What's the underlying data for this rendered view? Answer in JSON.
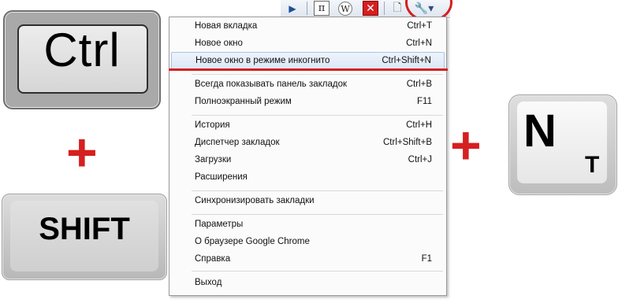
{
  "keys": {
    "ctrl": "Ctrl",
    "shift": "SHIFT",
    "n_main": "N",
    "n_sub": "T"
  },
  "plus": "+",
  "toolbar": {
    "play_icon": "▶",
    "pi_icon": "π",
    "wiki_icon": "W",
    "x_icon": "✕",
    "page_icon": "🗋",
    "wrench_icon": "🔧▾"
  },
  "menu": {
    "items": [
      {
        "label": "Новая вкладка",
        "shortcut": "Ctrl+T"
      },
      {
        "label": "Новое окно",
        "shortcut": "Ctrl+N"
      },
      {
        "label": "Новое окно в режиме инкогнито",
        "shortcut": "Ctrl+Shift+N"
      },
      {
        "label": "Всегда показывать панель закладок",
        "shortcut": "Ctrl+B"
      },
      {
        "label": "Полноэкранный режим",
        "shortcut": "F11"
      },
      {
        "label": "История",
        "shortcut": "Ctrl+H"
      },
      {
        "label": "Диспетчер закладок",
        "shortcut": "Ctrl+Shift+B"
      },
      {
        "label": "Загрузки",
        "shortcut": "Ctrl+J"
      },
      {
        "label": "Расширения",
        "shortcut": ""
      },
      {
        "label": "Синхронизировать закладки",
        "shortcut": ""
      },
      {
        "label": "Параметры",
        "shortcut": ""
      },
      {
        "label": "О браузере Google Chrome",
        "shortcut": ""
      },
      {
        "label": "Справка",
        "shortcut": "F1"
      },
      {
        "label": "Выход",
        "shortcut": ""
      }
    ]
  },
  "colors": {
    "accent_red": "#d42020",
    "highlight_border": "#a9c3e6"
  }
}
